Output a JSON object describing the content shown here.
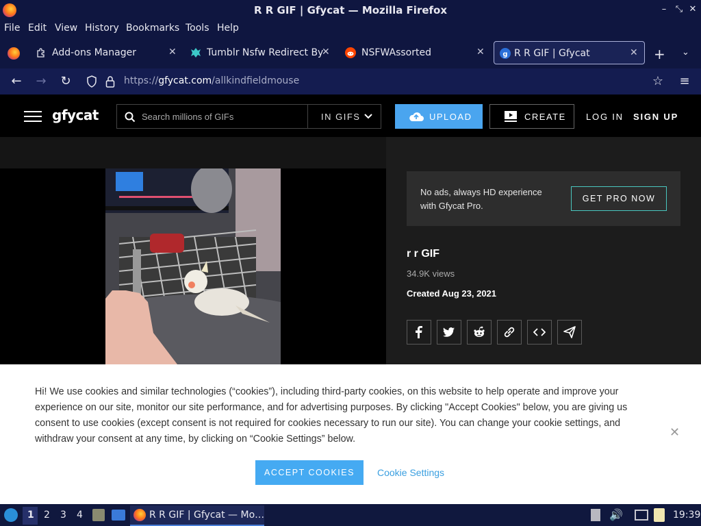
{
  "window": {
    "title": "R R GIF | Gfycat — Mozilla Firefox"
  },
  "menu": [
    "File",
    "Edit",
    "View",
    "History",
    "Bookmarks",
    "Tools",
    "Help"
  ],
  "tabs": [
    {
      "label": "Add-ons Manager",
      "icon": "puzzle-icon",
      "active": false
    },
    {
      "label": "Tumblr Nsfw Redirect Byp",
      "icon": "tumblr-ext-icon",
      "active": false
    },
    {
      "label": "NSFWAssorted",
      "icon": "reddit-icon",
      "active": false
    },
    {
      "label": "R R GIF | Gfycat",
      "icon": "gfycat-icon",
      "active": true
    }
  ],
  "nav": {
    "url_prefix": "https://",
    "url_host": "gfycat.com",
    "url_path": "/allkindfieldmouse"
  },
  "site": {
    "logo": "gfycat",
    "search_placeholder": "Search millions of GIFs",
    "search_filter": "IN GIFS",
    "upload": "UPLOAD",
    "create": "CREATE",
    "login": "LOG IN",
    "signup": "SIGN UP"
  },
  "promo": {
    "text": "No ads, always HD experience with Gfycat Pro.",
    "button": "GET PRO NOW"
  },
  "gif": {
    "title": "r r GIF",
    "views": "34.9K views",
    "created": "Created Aug 23, 2021"
  },
  "share": [
    "facebook-icon",
    "twitter-icon",
    "reddit-icon",
    "link-icon",
    "embed-icon",
    "send-icon"
  ],
  "cookie": {
    "message": "Hi! We use cookies and similar technologies (“cookies”), including third-party cookies, on this website to help operate and improve your experience on our site, monitor our site performance, and for advertising purposes. By clicking \"Accept Cookies\" below, you are giving us consent to use cookies (except consent is not required for cookies necessary to run our site). You can change your cookie settings, and withdraw your consent at any time, by clicking on “Cookie Settings” below.",
    "accept": "ACCEPT COOKIES",
    "settings": "Cookie Settings"
  },
  "taskbar": {
    "workspaces": [
      "1",
      "2",
      "3",
      "4"
    ],
    "active_task": "R R GIF | Gfycat — Mo…",
    "clock": "19:39"
  }
}
